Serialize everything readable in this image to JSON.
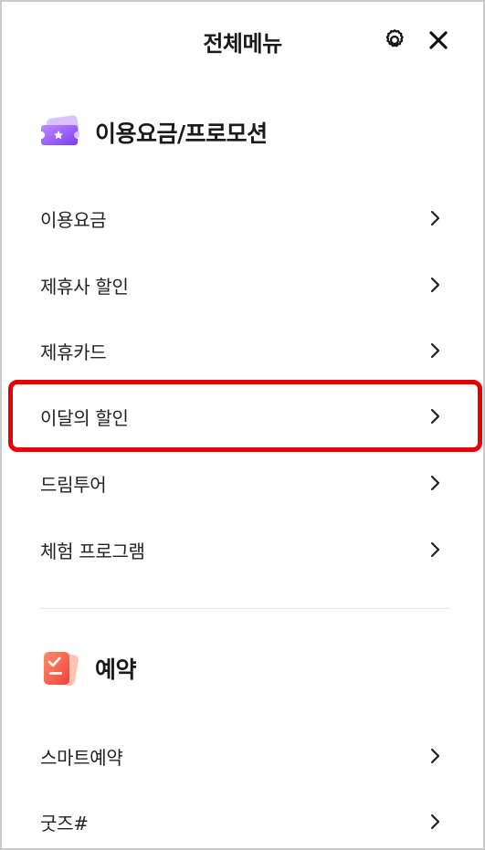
{
  "header": {
    "title": "전체메뉴",
    "settings_icon": "gear-icon",
    "close_icon": "close-icon"
  },
  "sections": [
    {
      "title": "이용요금/프로모션",
      "icon": "ticket-icon",
      "icon_color": "#a66bff",
      "items": [
        "이용요금",
        "제휴사 할인",
        "제휴카드",
        "이달의 할인",
        "드림투어",
        "체험 프로그램"
      ]
    },
    {
      "title": "예약",
      "icon": "reservation-check-icon",
      "icon_color": "#ff6a55",
      "items": [
        "스마트예약",
        "굿즈#"
      ]
    }
  ],
  "highlighted_item": "이달의 할인",
  "colors": {
    "highlight": "#e60000",
    "divider": "#e6e6e6",
    "text": "#1a1a1a"
  }
}
